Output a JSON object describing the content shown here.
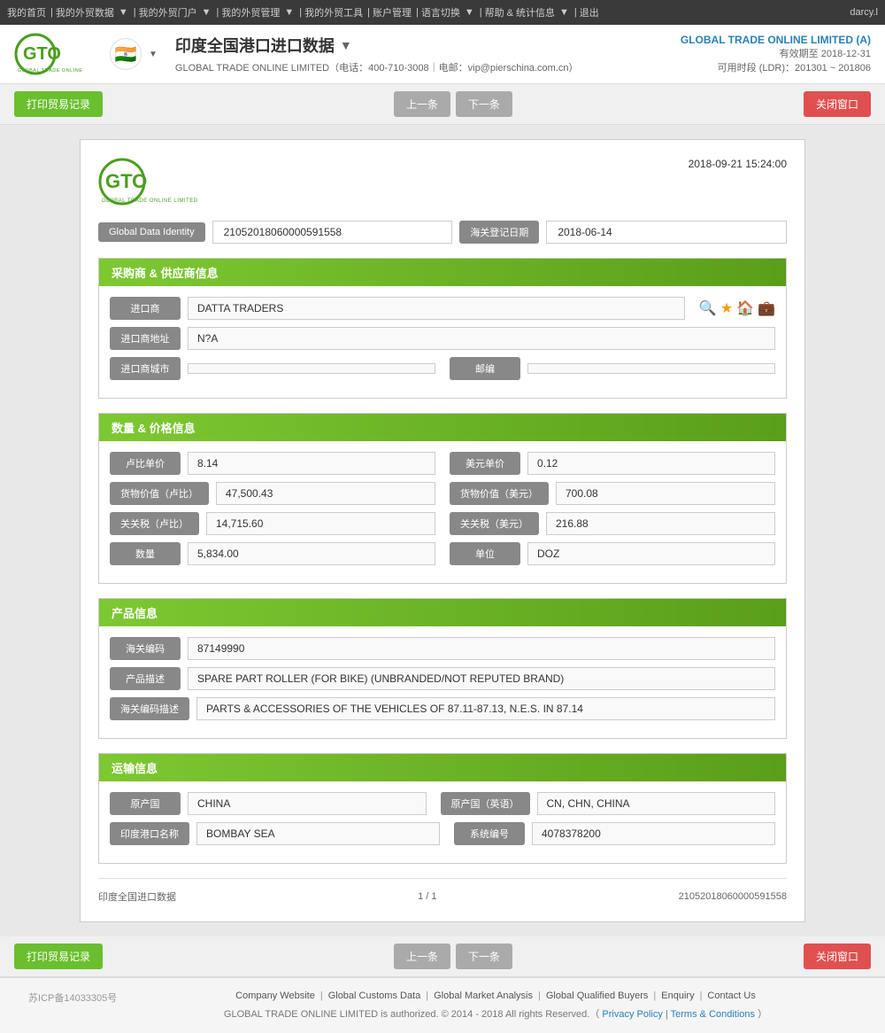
{
  "topnav": {
    "items": [
      "我的首页",
      "我的外贸数据",
      "我的外贸门户",
      "我的外贸管理",
      "我的外贸工具",
      "账户管理",
      "语言切换",
      "帮助 & 统计信息",
      "退出"
    ],
    "user": "darcy.l"
  },
  "header": {
    "company": "GLOBAL TRADE ONLINE LIMITED (A)",
    "valid": "有效期至 2018-12-31",
    "ldr": "可用时段 (LDR)：201301 ~ 201806",
    "title": "印度全国港口进口数据",
    "subtitle": "GLOBAL TRADE ONLINE LIMITED（电话：400-710-3008｜电邮：vip@pierschina.com.cn）"
  },
  "toolbar": {
    "print_label": "打印贸易记录",
    "prev_label": "上一条",
    "next_label": "下一条",
    "close_label": "关闭窗口"
  },
  "record": {
    "datetime": "2018-09-21 15:24:00",
    "gdi_label": "Global Data Identity",
    "gdi_value": "21052018060000591558",
    "date_label": "海关登记日期",
    "date_value": "2018-06-14",
    "section_buyer": {
      "title": "采购商 & 供应商信息",
      "importer_label": "进口商",
      "importer_value": "DATTA TRADERS",
      "address_label": "进口商地址",
      "address_value": "N?A",
      "city_label": "进口商城市",
      "city_value": "",
      "postal_label": "邮编",
      "postal_value": ""
    },
    "section_price": {
      "title": "数量 & 价格信息",
      "rupee_unit_label": "卢比单价",
      "rupee_unit_value": "8.14",
      "usd_unit_label": "美元单价",
      "usd_unit_value": "0.12",
      "rupee_val_label": "货物价值（卢比）",
      "rupee_val_value": "47,500.43",
      "usd_val_label": "货物价值（美元）",
      "usd_val_value": "700.08",
      "rupee_tax_label": "关关税（卢比）",
      "rupee_tax_value": "14,715.60",
      "usd_tax_label": "关关税（美元）",
      "usd_tax_value": "216.88",
      "qty_label": "数量",
      "qty_value": "5,834.00",
      "unit_label": "单位",
      "unit_value": "DOZ"
    },
    "section_product": {
      "title": "产品信息",
      "hs_label": "海关编码",
      "hs_value": "87149990",
      "desc_label": "产品描述",
      "desc_value": "SPARE PART ROLLER (FOR BIKE) (UNBRANDED/NOT REPUTED BRAND)",
      "hs_desc_label": "海关编码描述",
      "hs_desc_value": "PARTS & ACCESSORIES OF THE VEHICLES OF 87.11-87.13, N.E.S. IN 87.14"
    },
    "section_transport": {
      "title": "运输信息",
      "origin_cn_label": "原产国",
      "origin_cn_value": "CHINA",
      "origin_en_label": "原产国（英语）",
      "origin_en_value": "CN, CHN, CHINA",
      "port_label": "印度港口名称",
      "port_value": "BOMBAY SEA",
      "sys_label": "系统编号",
      "sys_value": "4078378200"
    },
    "footer": {
      "source": "印度全国进口数据",
      "page": "1 / 1",
      "id": "21052018060000591558"
    }
  },
  "page_footer": {
    "icp": "苏ICP备14033305号",
    "links": [
      "Company Website",
      "Global Customs Data",
      "Global Market Analysis",
      "Global Qualified Buyers",
      "Enquiry",
      "Contact Us"
    ],
    "copy": "GLOBAL TRADE ONLINE LIMITED is authorized. © 2014 - 2018 All rights Reserved.（",
    "privacy": "Privacy Policy",
    "terms": "Terms & Conditions",
    "copy_end": "）"
  }
}
